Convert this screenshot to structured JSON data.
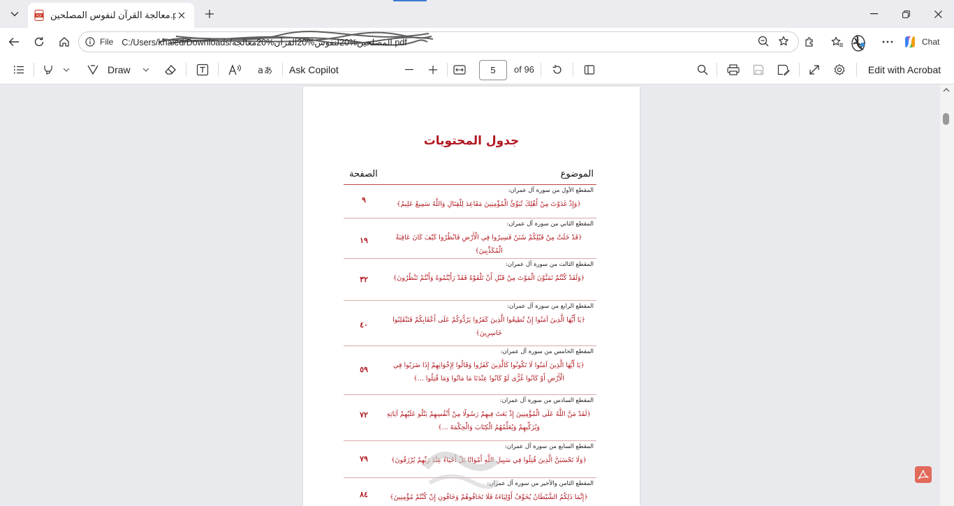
{
  "tab": {
    "title": "معالجة القرآن لنفوس المصلحين.pdf"
  },
  "address": {
    "scheme_label": "File",
    "url": "C:/Users/khaled/Downloads/المصلحين%20لنفوس%20القرآن%20معالجة.pdf"
  },
  "chat": {
    "label": "Chat"
  },
  "toolbar": {
    "draw_label": "Draw",
    "ask_copilot_label": "Ask Copilot",
    "page_current": "5",
    "page_total_label": "of 96",
    "edit_acrobat_label": "Edit with Acrobat"
  },
  "document": {
    "toc_title": "جدول المحتويات",
    "col_topic": "الموضوع",
    "col_page": "الصفحة",
    "entries": [
      {
        "label": "المقطع الأول من سورة آل عمران:",
        "verse": "﴿وَإِذْ غَدَوْتَ مِنْ أَهْلِكَ تُبَوِّئُ الْمُؤْمِنِينَ مَقَاعِدَ لِلْقِتَالِ وَاللَّهُ سَمِيعٌ عَلِيمٌ﴾",
        "page": "٩"
      },
      {
        "label": "المقطع الثاني من سورة آل عمران:",
        "verse": "﴿قَدْ خَلَتْ مِنْ قَبْلِكُمْ سُنَنٌ فَسِيرُوا فِي الْأَرْضِ فَانْظُرُوا كَيْفَ كَانَ عَاقِبَةُ الْمُكَذِّبِينَ﴾",
        "page": "١٩"
      },
      {
        "label": "المقطع الثالث من سورة آل عمران:",
        "verse": "﴿وَلَقَدْ كُنْتُمْ تَمَنَّوْنَ الْمَوْتَ مِنْ قَبْلِ أَنْ تَلْقَوْهُ فَقَدْ رَأَيْتُمُوهُ وَأَنْتُمْ تَنْظُرُونَ﴾",
        "page": "٣٢"
      },
      {
        "label": "المقطع الرابع من سورة آل عمران:",
        "verse": "﴿يَا أَيُّهَا الَّذِينَ آمَنُوا إِنْ تُطِيعُوا الَّذِينَ كَفَرُوا يَرُدُّوكُمْ عَلَى أَعْقَابِكُمْ فَتَنْقَلِبُوا خَاسِرِينَ﴾",
        "page": "٤٠"
      },
      {
        "label": "المقطع الخامس من سورة آل عمران:",
        "verse": "﴿يَا أَيُّهَا الَّذِينَ آمَنُوا لَا تَكُونُوا كَالَّذِينَ كَفَرُوا وَقَالُوا لِإِخْوَانِهِمْ إِذَا ضَرَبُوا فِي الْأَرْضِ أَوْ كَانُوا غُزًّى لَوْ كَانُوا عِنْدَنَا مَا مَاتُوا وَمَا قُتِلُوا ...﴾",
        "page": "٥٩"
      },
      {
        "label": "المقطع السادس من سورة آل عمران:",
        "verse": "﴿لَقَدْ مَنَّ اللَّهُ عَلَى الْمُؤْمِنِينَ إِذْ بَعَثَ فِيهِمْ رَسُولًا مِنْ أَنْفُسِهِمْ يَتْلُو عَلَيْهِمْ آيَاتِهِ وَيُزَكِّيهِمْ وَيُعَلِّمُهُمُ الْكِتَابَ وَالْحِكْمَةَ ...﴾",
        "page": "٧٢"
      },
      {
        "label": "المقطع السابع من سورة آل عمران:",
        "verse": "﴿وَلَا تَحْسَبَنَّ الَّذِينَ قُتِلُوا فِي سَبِيلِ اللَّهِ أَمْوَاتًا بَلْ أَحْيَاءٌ عِنْدَ رَبِّهِمْ يُرْزَقُونَ﴾",
        "page": "٧٩"
      },
      {
        "label": "المقطع الثامن والأخير من سورة آل عمران:",
        "verse": "﴿إِنَّمَا ذَلِكُمُ الشَّيْطَانُ يُخَوِّفُ أَوْلِيَاءَهُ فَلَا تَخَافُوهُمْ وَخَافُونِ إِنْ كُنْتُمْ مُؤْمِنِينَ﴾",
        "page": "٨٤"
      }
    ]
  },
  "colors": {
    "accent_red": "#b01820",
    "rule": "#d9a8a8",
    "viewer_bg": "#e9eaee"
  }
}
